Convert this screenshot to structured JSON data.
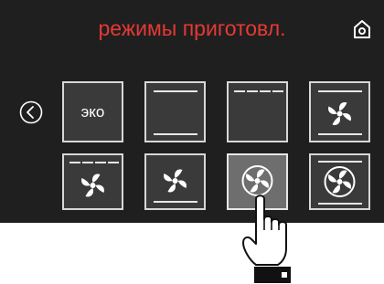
{
  "screen": {
    "title": "режимы приготовл.",
    "title_color": "#e53935",
    "background": "#1f1f1f"
  },
  "icons": {
    "home": "home-icon",
    "back": "chevron-left-circle-icon",
    "fan": "fan-icon",
    "pointer": "pointing-hand-icon"
  },
  "modes": [
    {
      "id": "eco",
      "label": "эко"
    },
    {
      "id": "top-bottom-heat",
      "label": ""
    },
    {
      "id": "top-heat-grill",
      "label": ""
    },
    {
      "id": "fan-top-bottom",
      "label": ""
    },
    {
      "id": "fan-grill",
      "label": ""
    },
    {
      "id": "fan-bottom",
      "label": ""
    },
    {
      "id": "convection-selected",
      "label": ""
    },
    {
      "id": "fan-ring-top-bottom",
      "label": ""
    }
  ],
  "selected_mode": "convection-selected"
}
